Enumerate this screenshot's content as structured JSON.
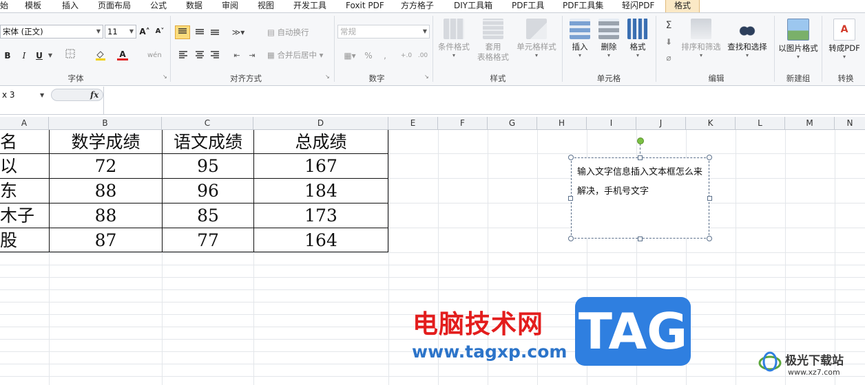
{
  "tabs": [
    "始",
    "模板",
    "插入",
    "页面布局",
    "公式",
    "数据",
    "审阅",
    "视图",
    "开发工具",
    "Foxit PDF",
    "方方格子",
    "DIY工具箱",
    "PDF工具",
    "PDF工具集",
    "轻闪PDF",
    "格式"
  ],
  "active_tab": "格式",
  "ribbon": {
    "font": {
      "name": "宋体 (正文)",
      "size": "11",
      "grow": "A˄",
      "shrink": "A˅",
      "bold": "B",
      "italic": "I",
      "underline": "U",
      "phonetic": "wén",
      "group_label": "字体"
    },
    "alignment": {
      "wrap": "自动换行",
      "merge": "合并后居中",
      "group_label": "对齐方式"
    },
    "number": {
      "format": "常规",
      "percent": "%",
      "comma": ",",
      "group_label": "数字"
    },
    "styles": {
      "conditional": "条件格式",
      "table_line1": "套用",
      "table_line2": "表格格式",
      "cell_styles": "单元格样式",
      "group_label": "样式"
    },
    "cells": {
      "insert": "插入",
      "delete": "删除",
      "format": "格式",
      "group_label": "单元格"
    },
    "editing": {
      "sigma": "Σ",
      "sort": "排序和筛选",
      "find": "查找和选择",
      "group_label": "编辑"
    },
    "newgroup": {
      "picture_format": "以图片格式",
      "group_label": "新建组"
    },
    "convert": {
      "to_pdf": "转成PDF",
      "group_label": "转换"
    }
  },
  "formula_bar": {
    "name_box": "x 3",
    "fx": "fx"
  },
  "columns": [
    "A",
    "B",
    "C",
    "D",
    "E",
    "F",
    "G",
    "H",
    "I",
    "J",
    "K",
    "L",
    "M",
    "N"
  ],
  "table": {
    "header": [
      "名",
      "数学成绩",
      "语文成绩",
      "总成绩"
    ],
    "rows": [
      [
        "以",
        "72",
        "95",
        "167"
      ],
      [
        "东",
        "88",
        "96",
        "184"
      ],
      [
        "木子",
        "88",
        "85",
        "173"
      ],
      [
        "股",
        "87",
        "77",
        "164"
      ]
    ]
  },
  "textbox": {
    "text": "输入文字信息插入文本框怎么来解决，手机号文字"
  },
  "watermark": {
    "site_cn": "电脑技术网",
    "site_url": "www.tagxp.com",
    "tag": "TAG",
    "brand": "极光下载站",
    "brand_url": "www.xz7.com"
  },
  "colors": {
    "accent_tab": "#fbe9c6",
    "watermark_red": "#e31d1d",
    "watermark_blue": "#2c74c9",
    "tag_bg": "#2f7fe0"
  }
}
